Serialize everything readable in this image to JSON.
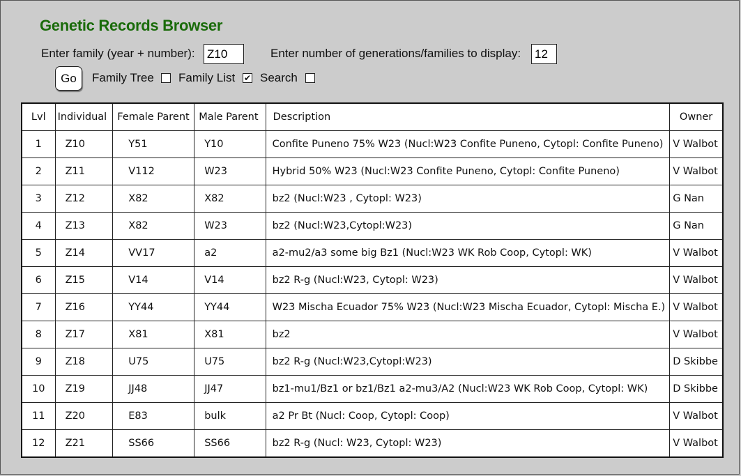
{
  "title": "Genetic Records Browser",
  "family_label": "Enter family (year + number):",
  "family_value": "Z10",
  "gen_label": "Enter number of generations/families to display:",
  "gen_value": "12",
  "go_label": "Go",
  "options": [
    {
      "label": "Family Tree",
      "checked": false
    },
    {
      "label": "Family List",
      "checked": true
    },
    {
      "label": "Search",
      "checked": false
    }
  ],
  "columns": [
    "Lvl",
    "Individual",
    "Female Parent",
    "Male Parent",
    "Description",
    "Owner"
  ],
  "rows": [
    [
      "1",
      "Z10",
      "Y51",
      "Y10",
      "Confite Puneno 75% W23 (Nucl:W23 Confite Puneno, Cytopl: Confite Puneno)",
      "V Walbot"
    ],
    [
      "2",
      "Z11",
      "V112",
      "W23",
      "Hybrid 50% W23 (Nucl:W23 Confite Puneno, Cytopl: Confite Puneno)",
      "V Walbot"
    ],
    [
      "3",
      "Z12",
      "X82",
      "X82",
      "bz2 (Nucl:W23 , Cytopl: W23)",
      "G Nan"
    ],
    [
      "4",
      "Z13",
      "X82",
      "W23",
      "bz2 (Nucl:W23,Cytopl:W23)",
      "G Nan"
    ],
    [
      "5",
      "Z14",
      "VV17",
      "a2",
      "a2-mu2/a3 some big Bz1 (Nucl:W23 WK Rob Coop, Cytopl: WK)",
      "V Walbot"
    ],
    [
      "6",
      "Z15",
      "V14",
      "V14",
      "bz2 R-g (Nucl:W23, Cytopl: W23)",
      "V Walbot"
    ],
    [
      "7",
      "Z16",
      "YY44",
      "YY44",
      "W23 Mischa Ecuador 75% W23 (Nucl:W23 Mischa Ecuador, Cytopl: Mischa E.)",
      "V Walbot"
    ],
    [
      "8",
      "Z17",
      "X81",
      "X81",
      "bz2",
      "V Walbot"
    ],
    [
      "9",
      "Z18",
      "U75",
      "U75",
      "bz2 R-g (Nucl:W23,Cytopl:W23)",
      "D Skibbe"
    ],
    [
      "10",
      "Z19",
      "JJ48",
      "JJ47",
      "bz1-mu1/Bz1 or bz1/Bz1 a2-mu3/A2 (Nucl:W23 WK Rob Coop, Cytopl: WK)",
      "D Skibbe"
    ],
    [
      "11",
      "Z20",
      "E83",
      "bulk",
      "a2 Pr Bt (Nucl: Coop, Cytopl: Coop)",
      "V Walbot"
    ],
    [
      "12",
      "Z21",
      "SS66",
      "SS66",
      "bz2 R-g (Nucl: W23, Cytopl: W23)",
      "V Walbot"
    ]
  ]
}
